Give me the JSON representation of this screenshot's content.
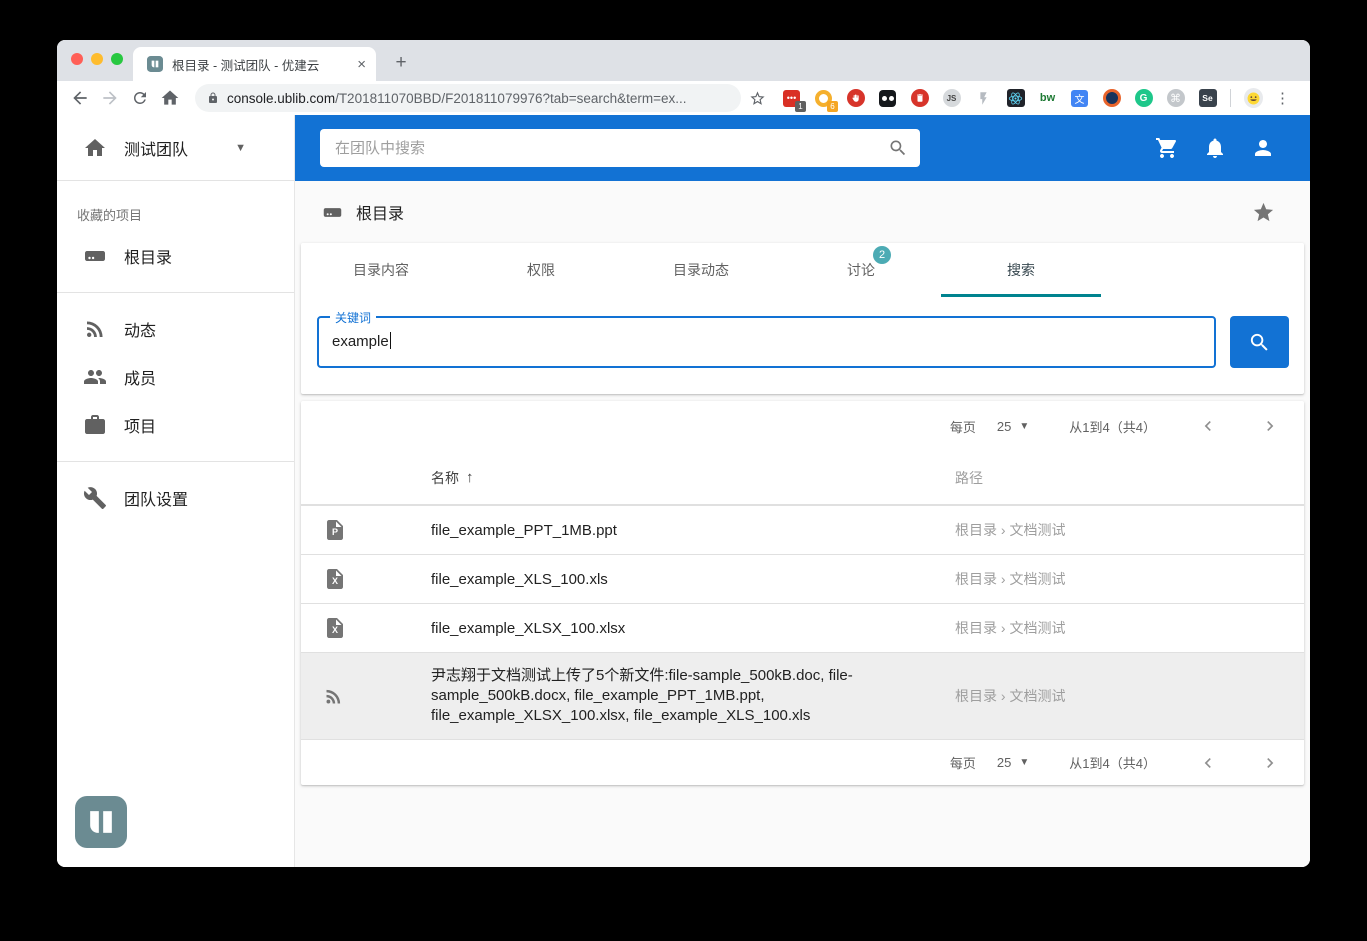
{
  "browser": {
    "tab_title": "根目录 - 测试团队 - 优建云",
    "tab_close": "×",
    "new_tab_label": "+",
    "url_domain": "console.ublib.com",
    "url_path": "/T201811070BBD/F201811079976?tab=search&term=ex...",
    "menu_glyph": "⋮",
    "extensions": {
      "redpin_badge": "1",
      "honey_badge": "6",
      "js_label": "JS",
      "bw_label": "bw",
      "translate_glyph": "文",
      "grammarly_label": "G",
      "cmd_glyph": "⌘",
      "selenium_label": "Se"
    }
  },
  "sidebar": {
    "team_name": "测试团队",
    "section_label": "收藏的项目",
    "favorite_label": "根目录",
    "items": [
      {
        "label": "动态",
        "icon": "rss"
      },
      {
        "label": "成员",
        "icon": "people"
      },
      {
        "label": "项目",
        "icon": "briefcase"
      }
    ],
    "settings_label": "团队设置"
  },
  "appbar": {
    "search_placeholder": "在团队中搜索"
  },
  "page": {
    "title": "根目录",
    "tabs": [
      {
        "label": "目录内容"
      },
      {
        "label": "权限"
      },
      {
        "label": "目录动态"
      },
      {
        "label": "讨论",
        "badge": "2"
      },
      {
        "label": "搜索",
        "active": true
      }
    ],
    "search_label": "关键词",
    "search_value": "example",
    "pagination": {
      "per_page_label": "每页",
      "per_page_value": "25",
      "range_text": "从1到4（共4）"
    },
    "columns": {
      "name": "名称",
      "sort_arrow": "↑",
      "path": "路径"
    },
    "rows": [
      {
        "icon": "file-ppt",
        "letter": "P",
        "name": "file_example_PPT_1MB.ppt",
        "path": "根目录 › 文档测试"
      },
      {
        "icon": "file-xls",
        "letter": "X",
        "name": "file_example_XLS_100.xls",
        "path": "根目录 › 文档测试"
      },
      {
        "icon": "file-xlsx",
        "letter": "X",
        "name": "file_example_XLSX_100.xlsx",
        "path": "根目录 › 文档测试"
      },
      {
        "icon": "rss",
        "name": "尹志翔于文档测试上传了5个新文件:file-sample_500kB.doc, file-sample_500kB.docx, file_example_PPT_1MB.ppt, file_example_XLSX_100.xlsx, file_example_XLS_100.xls",
        "path": "根目录 › 文档测试",
        "highlight": true
      }
    ]
  },
  "colors": {
    "primary_blue": "#1272d4",
    "teal_underline": "#00838f",
    "teal_badge": "#4cabb4",
    "logo_teal": "#6b8b92",
    "row_highlight": "#eeeeee"
  }
}
